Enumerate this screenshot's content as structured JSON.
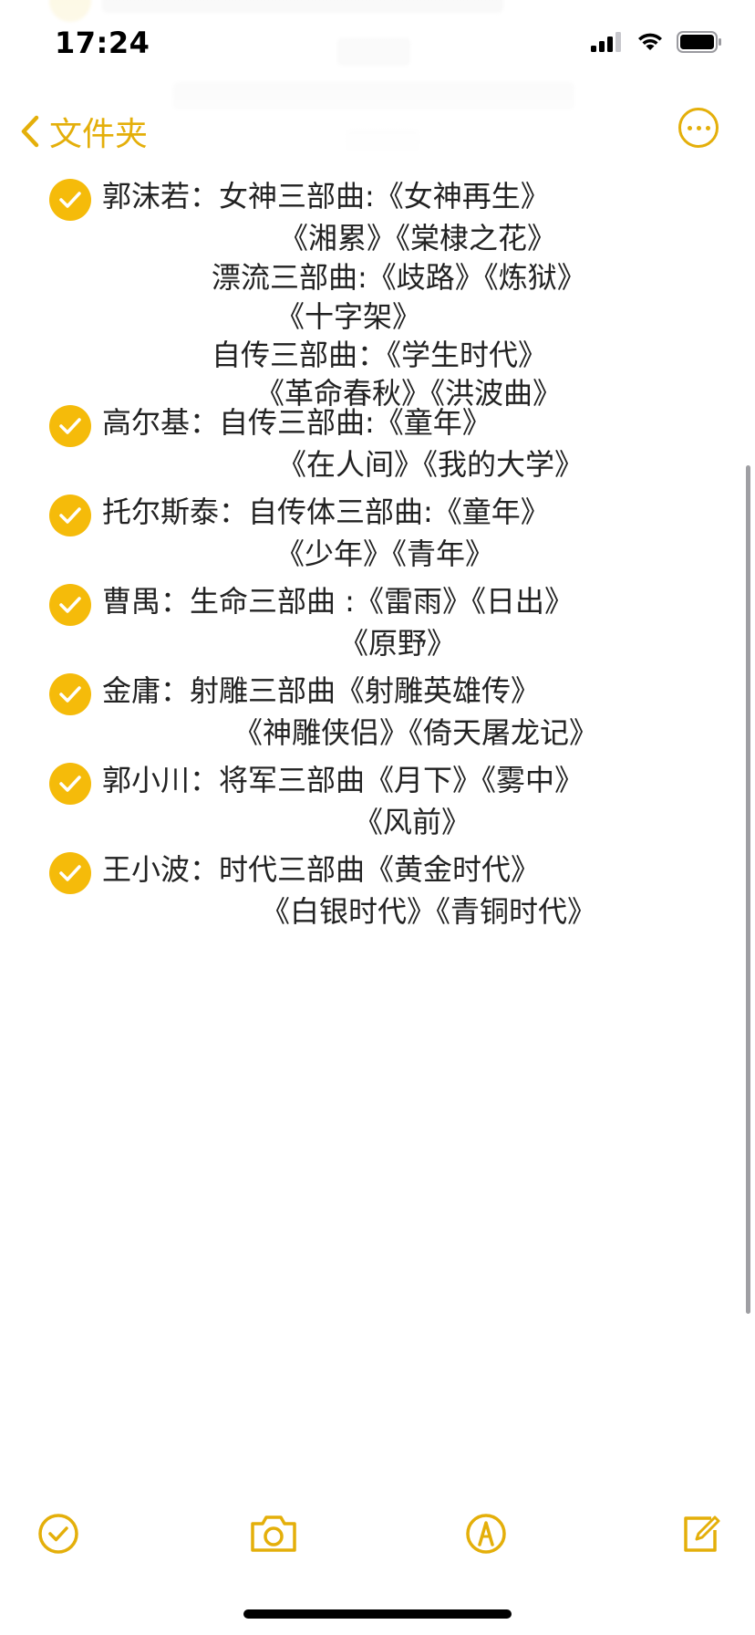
{
  "status_bar": {
    "time": "17:24"
  },
  "nav": {
    "back_label": "文件夹"
  },
  "checklist": [
    {
      "lines": [
        "郭沫若：女神三部曲:《女神再生》",
        "《湘累》《棠棣之花》",
        "漂流三部曲:《歧路》《炼狱》",
        "《十字架》",
        "自传三部曲：《学生时代》",
        "《革命春秋》《洪波曲》"
      ],
      "checked": true
    },
    {
      "lines": [
        "高尔基：自传三部曲:《童年》",
        "《在人间》《我的大学》"
      ],
      "checked": true
    },
    {
      "lines": [
        "托尔斯泰：自传体三部曲:《童年》",
        "《少年》《青年》"
      ],
      "checked": true
    },
    {
      "lines": [
        "曹禺：生命三部曲 :《雷雨》《日出》",
        "《原野》"
      ],
      "checked": true
    },
    {
      "lines": [
        "金庸：射雕三部曲《射雕英雄传》",
        "《神雕侠侣》《倚天屠龙记》"
      ],
      "checked": true
    },
    {
      "lines": [
        "郭小川：将军三部曲《月下》《雾中》",
        "《风前》"
      ],
      "checked": true
    },
    {
      "lines": [
        "王小波：时代三部曲《黄金时代》",
        "《白银时代》《青铜时代》"
      ],
      "checked": true
    }
  ],
  "colors": {
    "accent": "#e4af0a",
    "check_fill": "#f5bb0a"
  },
  "icons": {
    "toolbar": [
      "checklist-icon",
      "camera-icon",
      "markup-icon",
      "compose-icon"
    ]
  }
}
